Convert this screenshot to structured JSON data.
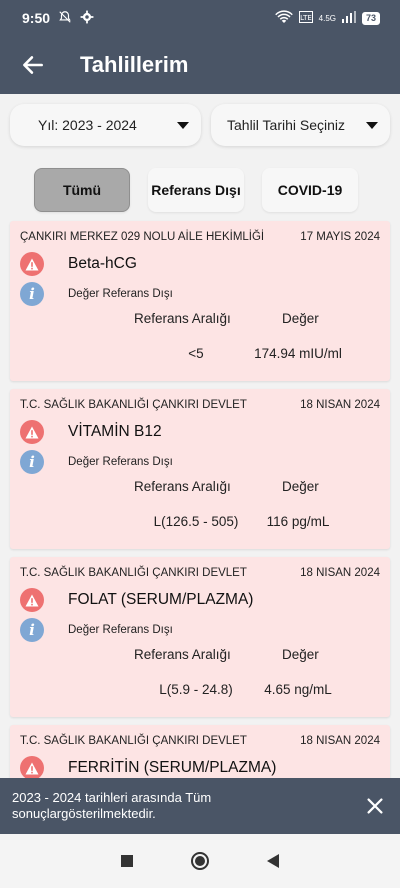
{
  "status": {
    "time": "9:50",
    "battery": "73",
    "network": "4.5G"
  },
  "appbar": {
    "title": "Tahlillerim"
  },
  "filters": {
    "year": "Yıl: 2023 - 2024",
    "date": "Tahlil Tarihi Seçiniz"
  },
  "chips": [
    {
      "label": "Tümü",
      "active": true
    },
    {
      "label": "Referans Dışı",
      "active": false
    },
    {
      "label": "COVID-19",
      "active": false
    }
  ],
  "columns": {
    "reference": "Referans Aralığı",
    "value": "Değer"
  },
  "results": [
    {
      "institution": "ÇANKIRI MERKEZ 029 NOLU AİLE HEKİMLİĞİ",
      "date": "17 MAYIS 2024",
      "test": "Beta-hCG",
      "status": "Değer Referans Dışı",
      "reference": "<5",
      "value": "174.94 mIU/ml"
    },
    {
      "institution": "T.C. SAĞLIK BAKANLIĞI ÇANKIRI DEVLET",
      "date": "18 NISAN 2024",
      "test": "VİTAMİN B12",
      "status": "Değer Referans Dışı",
      "reference": "L(126.5 - 505)",
      "value": "116 pg/mL"
    },
    {
      "institution": "T.C. SAĞLIK BAKANLIĞI ÇANKIRI DEVLET",
      "date": "18 NISAN 2024",
      "test": "FOLAT (SERUM/PLAZMA)",
      "status": "Değer Referans Dışı",
      "reference": "L(5.9 - 24.8)",
      "value": "4.65 ng/mL"
    },
    {
      "institution": "T.C. SAĞLIK BAKANLIĞI ÇANKIRI DEVLET",
      "date": "18 NISAN 2024",
      "test": "FERRİTİN (SERUM/PLAZMA)",
      "status": "",
      "reference": "",
      "value": ""
    }
  ],
  "snackbar": {
    "line1": "2023 - 2024 tarihleri arasında Tüm",
    "line2": "sonuçlargösterilmektedir."
  },
  "icons": {
    "warning": "warning-icon",
    "info": "info-icon",
    "back": "arrow-left-icon",
    "close": "close-icon"
  },
  "colors": {
    "bar": "#4a5566",
    "card": "#fde4e4",
    "warning": "#ee7171",
    "info": "#7fa7d4",
    "activeChip": "#a9a9a9"
  }
}
